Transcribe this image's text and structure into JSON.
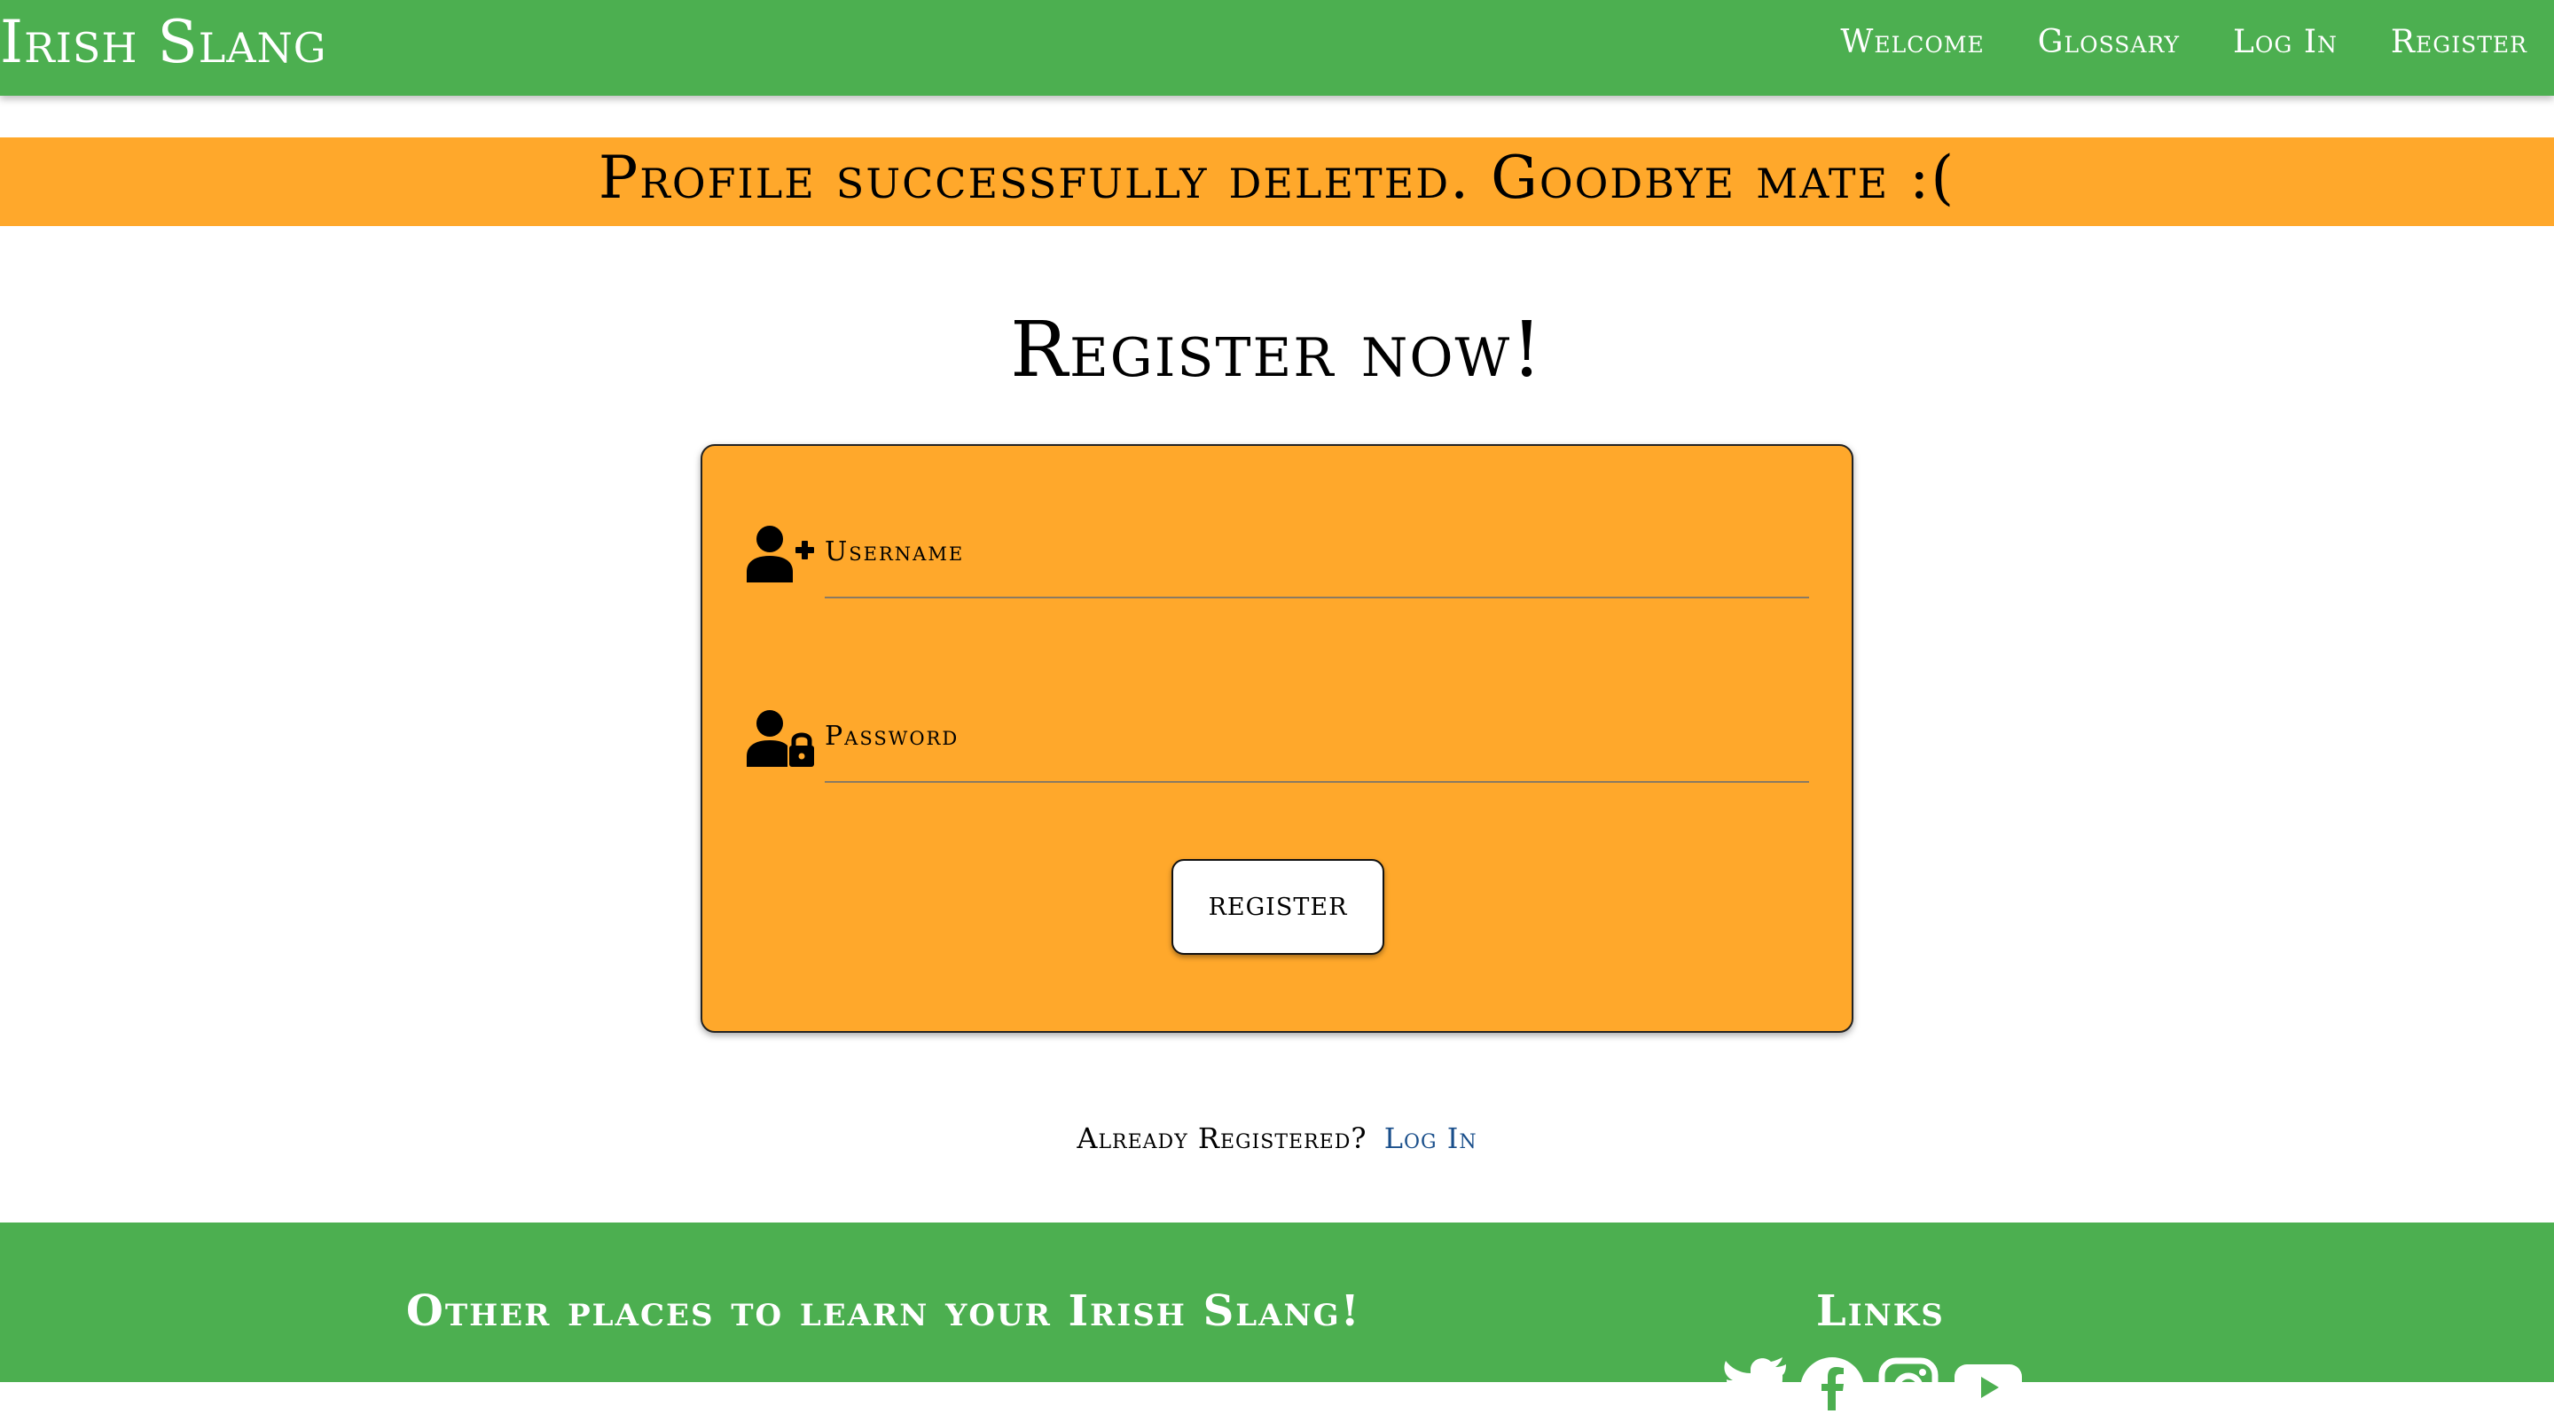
{
  "navbar": {
    "brand": "Irish Slang",
    "links": [
      "Welcome",
      "Glossary",
      "Log In",
      "Register"
    ]
  },
  "flash": {
    "message": "Profile successfully deleted. Goodbye mate :("
  },
  "main": {
    "title": "Register now!",
    "form": {
      "username_label": "Username",
      "password_label": "Password",
      "submit_label": "REGISTER"
    },
    "already": {
      "text": "Already Registered?",
      "link": "Log In"
    }
  },
  "footer": {
    "left_heading": "Other places to learn your Irish Slang!",
    "right_heading": "Links",
    "social_icons": [
      "twitter-icon",
      "facebook-icon",
      "instagram-icon",
      "youtube-icon"
    ]
  },
  "colors": {
    "nav_green": "#4caf50",
    "accent_orange": "#ffa82b",
    "link_blue": "#1a4f8b"
  }
}
